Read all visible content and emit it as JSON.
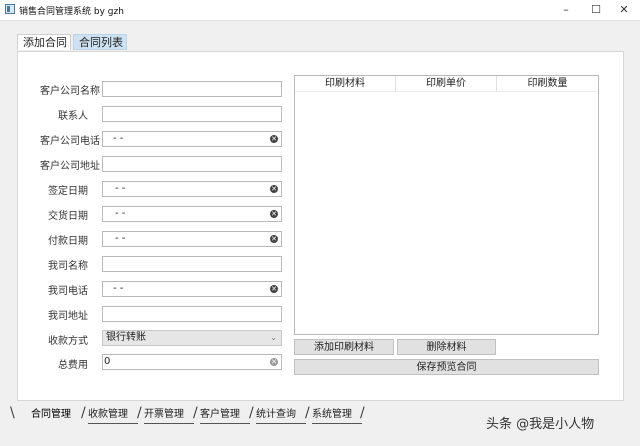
{
  "window": {
    "title": "销售合同管理系统 by gzh",
    "minimize": "–",
    "maximize": "☐",
    "close": "✕"
  },
  "top_tabs": [
    {
      "label": "添加合同"
    },
    {
      "label": "合同列表"
    }
  ],
  "form": {
    "fields": [
      {
        "label": "客户公司名称",
        "value": ""
      },
      {
        "label": "联系人",
        "value": ""
      },
      {
        "label": "客户公司电话",
        "value": "-   -"
      },
      {
        "label": "客户公司地址",
        "value": ""
      },
      {
        "label": "签定日期",
        "value": "-  -"
      },
      {
        "label": "交货日期",
        "value": "-  -"
      },
      {
        "label": "付款日期",
        "value": "-  -"
      },
      {
        "label": "我司名称",
        "value": ""
      },
      {
        "label": "我司电话",
        "value": "-   -"
      },
      {
        "label": "我司地址",
        "value": ""
      },
      {
        "label": "收款方式",
        "value": "银行转账"
      },
      {
        "label": "总费用",
        "value": "0"
      }
    ]
  },
  "table": {
    "columns": [
      "印刷材料",
      "印刷单价",
      "印刷数量"
    ]
  },
  "buttons": {
    "add_material": "添加印刷材料",
    "delete_material": "删除材料",
    "save_preview": "保存预览合同"
  },
  "bottom_tabs": [
    "合同管理",
    "收款管理",
    "开票管理",
    "客户管理",
    "统计查询",
    "系统管理"
  ],
  "watermark": "头条 @我是小人物"
}
